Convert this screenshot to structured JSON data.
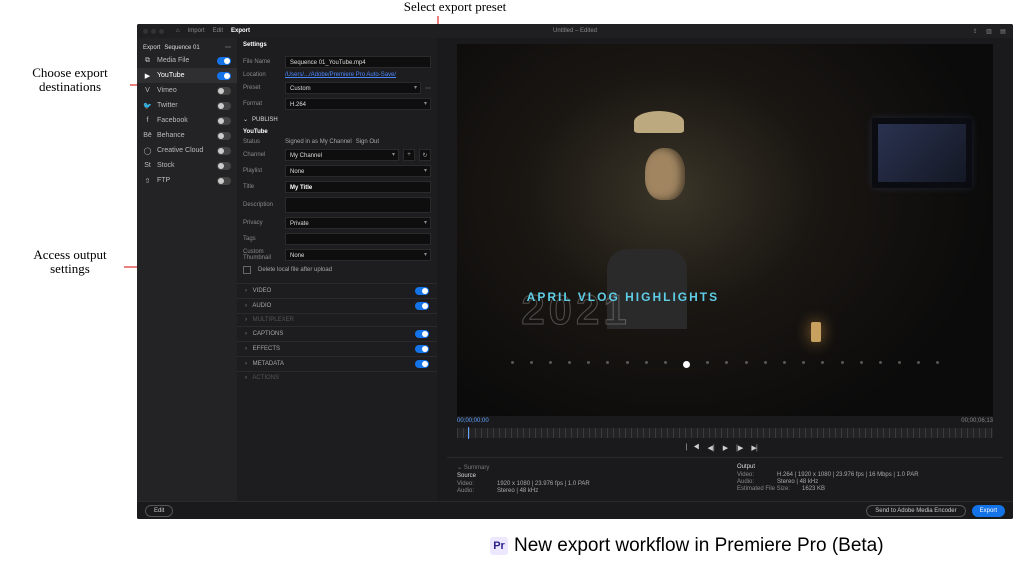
{
  "callouts": {
    "preset": "Select export preset",
    "dest": "Choose export destinations",
    "output": "Access output settings"
  },
  "caption": "New export workflow in Premiere Pro (Beta)",
  "pr_badge": "Pr",
  "titlebar": {
    "tabs": [
      "Import",
      "Edit",
      "Export"
    ],
    "active_tab": 2,
    "project": "Untitled – Edited"
  },
  "sidebar": {
    "head_label": "Export",
    "head_seq": "Sequence 01",
    "items": [
      {
        "icon": "⧉",
        "label": "Media File",
        "on": true
      },
      {
        "icon": "▶",
        "label": "YouTube",
        "on": true,
        "active": true
      },
      {
        "icon": "V",
        "label": "Vimeo",
        "on": false
      },
      {
        "icon": "🐦",
        "label": "Twitter",
        "on": false
      },
      {
        "icon": "f",
        "label": "Facebook",
        "on": false
      },
      {
        "icon": "Bē",
        "label": "Behance",
        "on": false
      },
      {
        "icon": "◯",
        "label": "Creative Cloud",
        "on": false
      },
      {
        "icon": "St",
        "label": "Stock",
        "on": false
      },
      {
        "icon": "⇧",
        "label": "FTP",
        "on": false
      }
    ]
  },
  "settings": {
    "title": "Settings",
    "filename_lbl": "File Name",
    "filename_val": "Sequence 01_YouTube.mp4",
    "location_lbl": "Location",
    "location_val": "/Users/.../Adobe/Premiere Pro Auto-Save/",
    "preset_lbl": "Preset",
    "preset_val": "Custom",
    "format_lbl": "Format",
    "format_val": "H.264",
    "publish_lbl": "PUBLISH",
    "youtube_lbl": "YouTube",
    "status_lbl": "Status",
    "status_val": "Signed in as My Channel",
    "signout": "Sign Out",
    "channel_lbl": "Channel",
    "channel_val": "My Channel",
    "playlist_lbl": "Playlist",
    "playlist_val": "None",
    "title_lbl": "Title",
    "title_val": "My Title",
    "desc_lbl": "Description",
    "desc_val": "",
    "privacy_lbl": "Privacy",
    "privacy_val": "Private",
    "tags_lbl": "Tags",
    "tags_val": "",
    "thumb_lbl": "Custom Thumbnail",
    "thumb_val": "None",
    "delete_local": "Delete local file after upload",
    "sections": [
      {
        "label": "VIDEO",
        "on": true
      },
      {
        "label": "AUDIO",
        "on": true
      },
      {
        "label": "MULTIPLEXER",
        "on": null
      },
      {
        "label": "CAPTIONS",
        "on": true
      },
      {
        "label": "EFFECTS",
        "on": true
      },
      {
        "label": "METADATA",
        "on": true
      },
      {
        "label": "ACTIONS",
        "on": null
      }
    ]
  },
  "preview": {
    "year": "2021",
    "vlog": "APRIL VLOG HIGHLIGHTS",
    "tc_left": "00;00;00;00",
    "tc_right": "00;00;06;13"
  },
  "summary": {
    "head": "Summary",
    "source_h": "Source",
    "out_h": "Output",
    "src_video": "1920 x 1080 | 23.976 fps | 1.0 PAR",
    "src_audio": "Stereo | 48 kHz",
    "out_video": "H.264 | 1920 x 1080 | 23.976 fps | 16 Mbps | 1.0 PAR",
    "out_audio": "Stereo | 48 kHz",
    "fs_lbl": "Estimated File Size:",
    "fs_val": "1623 KB",
    "video_k": "Video:",
    "audio_k": "Audio:"
  },
  "footer": {
    "edit": "Edit",
    "encoder": "Send to Adobe Media Encoder",
    "export": "Export"
  }
}
